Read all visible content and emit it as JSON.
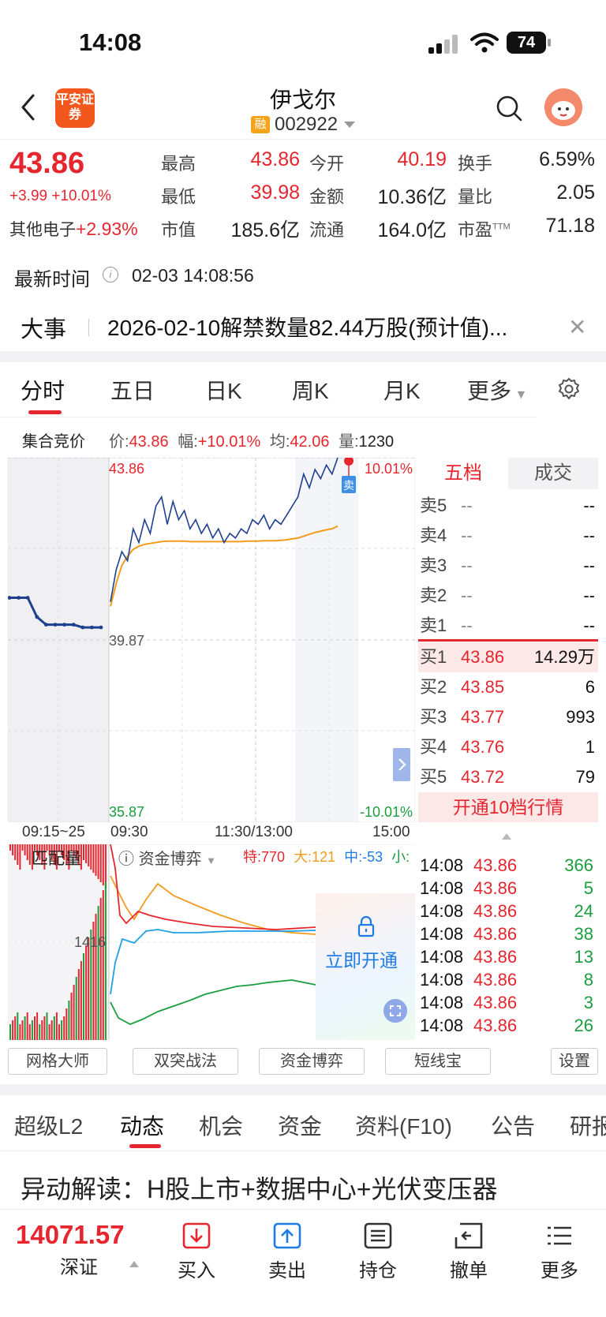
{
  "status_bar": {
    "time": "14:08",
    "battery": "74"
  },
  "header": {
    "logo_text": "平安证券",
    "stock_name": "伊戈尔",
    "margin_badge": "融",
    "stock_code": "002922"
  },
  "quote": {
    "price": "43.86",
    "change": "+3.99",
    "change_pct": "+10.01%",
    "sector_name": "其他电子",
    "sector_pct": "+2.93%",
    "high_label": "最高",
    "high": "43.86",
    "open_label": "今开",
    "open": "40.19",
    "turnover_label": "换手",
    "turnover": "6.59%",
    "low_label": "最低",
    "low": "39.98",
    "amount_label": "金额",
    "amount": "10.36亿",
    "vol_ratio_label": "量比",
    "vol_ratio": "2.05",
    "mktcap_label": "市值",
    "mktcap": "185.6亿",
    "float_label": "流通",
    "float": "164.0亿",
    "pe_label": "市盈",
    "pe_sup": "TTM",
    "pe": "71.18",
    "update_label": "最新时间",
    "update_time": "02-03 14:08:56"
  },
  "event": {
    "label": "大事",
    "text": "2026-02-10解禁数量82.44万股(预计值)..."
  },
  "chart_tabs": [
    "分时",
    "五日",
    "日K",
    "周K",
    "月K",
    "更多"
  ],
  "auction": {
    "label": "集合竞价",
    "price_label": "价:",
    "price": "43.86",
    "pct_label": "幅:",
    "pct": "+10.01%",
    "avg_label": "均:",
    "avg": "42.06",
    "vol_label": "量:",
    "vol": "1230"
  },
  "chart_data": {
    "type": "line",
    "y_top": "43.86",
    "y_mid": "39.87",
    "y_bottom": "35.87",
    "pct_top": "10.01%",
    "pct_bottom": "-10.01%",
    "sell_marker": "卖",
    "x_labels": [
      "09:15~25",
      "09:30",
      "11:30/13:00",
      "15:00"
    ],
    "ylim": [
      35.87,
      43.86
    ],
    "auction_series": {
      "name": "",
      "values": [
        40.79,
        40.79,
        40.79,
        40.37,
        40.2,
        40.2,
        40.2,
        40.2,
        40.14,
        40.14,
        40.14
      ]
    },
    "series": [
      {
        "name": "",
        "values": [
          40.7,
          41.4,
          41.8,
          41.6,
          42.3,
          42.0,
          42.5,
          42.2,
          42.8,
          43.0,
          42.4,
          42.9,
          42.5,
          42.7,
          42.3,
          42.5,
          42.2,
          42.4,
          42.1,
          42.3,
          42.0,
          42.2,
          42.1,
          42.3,
          42.2,
          42.5,
          42.4,
          42.6,
          42.3,
          42.5,
          42.4,
          42.6,
          42.8,
          43.0,
          43.5,
          43.2,
          43.6,
          43.4,
          43.7,
          43.5,
          43.86
        ]
      },
      {
        "name": "",
        "values": [
          40.6,
          41.1,
          41.5,
          41.7,
          41.85,
          41.92,
          41.96,
          41.98,
          42.0,
          42.02,
          42.03,
          42.03,
          42.03,
          42.03,
          42.02,
          42.02,
          42.02,
          42.02,
          42.02,
          42.02,
          42.02,
          42.02,
          42.02,
          42.02,
          42.03,
          42.03,
          42.03,
          42.04,
          42.04,
          42.04,
          42.05,
          42.06,
          42.08,
          42.1,
          42.14,
          42.18,
          42.22,
          42.25,
          42.28,
          42.3,
          42.36
        ]
      }
    ]
  },
  "order_book": {
    "tab_active": "五档",
    "tab_other": "成交",
    "asks": [
      {
        "name": "卖5",
        "price": "--",
        "vol": "--"
      },
      {
        "name": "卖4",
        "price": "--",
        "vol": "--"
      },
      {
        "name": "卖3",
        "price": "--",
        "vol": "--"
      },
      {
        "name": "卖2",
        "price": "--",
        "vol": "--"
      },
      {
        "name": "卖1",
        "price": "--",
        "vol": "--"
      }
    ],
    "bids": [
      {
        "name": "买1",
        "price": "43.86",
        "vol": "14.29万"
      },
      {
        "name": "买2",
        "price": "43.85",
        "vol": "6"
      },
      {
        "name": "买3",
        "price": "43.77",
        "vol": "993"
      },
      {
        "name": "买4",
        "price": "43.76",
        "vol": "1"
      },
      {
        "name": "买5",
        "price": "43.72",
        "vol": "79"
      }
    ],
    "open10": "开通10档行情"
  },
  "trades": [
    {
      "time": "14:08",
      "price": "43.86",
      "vol": "366"
    },
    {
      "time": "14:08",
      "price": "43.86",
      "vol": "5"
    },
    {
      "time": "14:08",
      "price": "43.86",
      "vol": "24"
    },
    {
      "time": "14:08",
      "price": "43.86",
      "vol": "38"
    },
    {
      "time": "14:08",
      "price": "43.86",
      "vol": "13"
    },
    {
      "time": "14:08",
      "price": "43.86",
      "vol": "8"
    },
    {
      "time": "14:08",
      "price": "43.86",
      "vol": "3"
    },
    {
      "time": "14:08",
      "price": "43.86",
      "vol": "26"
    }
  ],
  "lower": {
    "match_label": "匹配量",
    "match_value": "1416",
    "fund_label": "资金博弈",
    "special": "特:770",
    "large": "大:121",
    "mid": "中:-53",
    "small": "小:",
    "unlock": "立即开通"
  },
  "tools": [
    "网格大师",
    "双突战法",
    "资金博弈",
    "短线宝",
    "设置"
  ],
  "bottom_tabs": [
    "超级L2",
    "动态",
    "机会",
    "资金",
    "资料(F10)",
    "公告",
    "研报"
  ],
  "news_title": "异动解读：H股上市+数据中心+光伏变压器",
  "bottom_bar": {
    "index_value": "14071.57",
    "index_name": "深证",
    "buttons": [
      "买入",
      "卖出",
      "持仓",
      "撤单",
      "更多"
    ]
  },
  "colors": {
    "up": "#e5262e",
    "down": "#1a9e3e",
    "price_line": "#1f3f8f",
    "avg_line": "#f29b1d",
    "accent": "#1e7be6"
  }
}
